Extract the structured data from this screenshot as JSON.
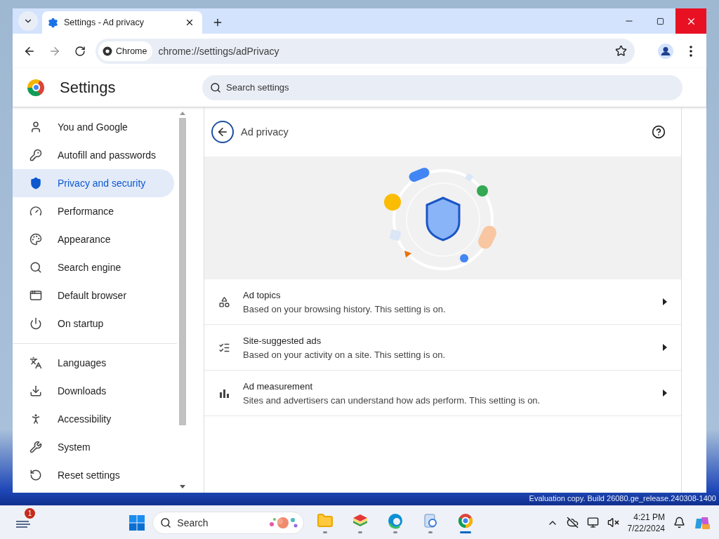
{
  "window": {
    "tab": {
      "title": "Settings - Ad privacy"
    },
    "address": {
      "chip": "Chrome",
      "url": "chrome://settings/adPrivacy"
    }
  },
  "settings": {
    "title": "Settings",
    "search": {
      "placeholder": "Search settings"
    }
  },
  "sidebar": {
    "groups": [
      [
        {
          "kind": "person",
          "label": "You and Google",
          "selected": false
        },
        {
          "kind": "key",
          "label": "Autofill and passwords",
          "selected": false
        },
        {
          "kind": "shield",
          "label": "Privacy and security",
          "selected": true
        },
        {
          "kind": "gauge",
          "label": "Performance",
          "selected": false
        },
        {
          "kind": "palette",
          "label": "Appearance",
          "selected": false
        },
        {
          "kind": "search",
          "label": "Search engine",
          "selected": false
        },
        {
          "kind": "browser",
          "label": "Default browser",
          "selected": false
        },
        {
          "kind": "power",
          "label": "On startup",
          "selected": false
        }
      ],
      [
        {
          "kind": "languages",
          "label": "Languages",
          "selected": false
        },
        {
          "kind": "download",
          "label": "Downloads",
          "selected": false
        },
        {
          "kind": "accessibility",
          "label": "Accessibility",
          "selected": false
        },
        {
          "kind": "wrench",
          "label": "System",
          "selected": false
        },
        {
          "kind": "reset",
          "label": "Reset settings",
          "selected": false
        }
      ]
    ]
  },
  "page": {
    "title": "Ad privacy",
    "rows": [
      {
        "kind": "topics",
        "title": "Ad topics",
        "description": "Based on your browsing history. This setting is on."
      },
      {
        "kind": "suggested",
        "title": "Site-suggested ads",
        "description": "Based on your activity on a site. This setting is on."
      },
      {
        "kind": "measurement",
        "title": "Ad measurement",
        "description": "Sites and advertisers can understand how ads perform. This setting is on."
      }
    ]
  },
  "desktop": {
    "notice": "Evaluation copy. Build 26080.ge_release.240308-1400"
  },
  "taskbar": {
    "widgets_badge": "1",
    "search": {
      "placeholder": "Search"
    },
    "apps": [
      {
        "kind": "files",
        "selected": false
      },
      {
        "kind": "stack",
        "selected": false
      },
      {
        "kind": "edge",
        "selected": false
      },
      {
        "kind": "tool",
        "selected": false
      },
      {
        "kind": "chrome",
        "selected": true
      }
    ],
    "clock": {
      "time": "4:21 PM",
      "date": "7/22/2024"
    }
  }
}
